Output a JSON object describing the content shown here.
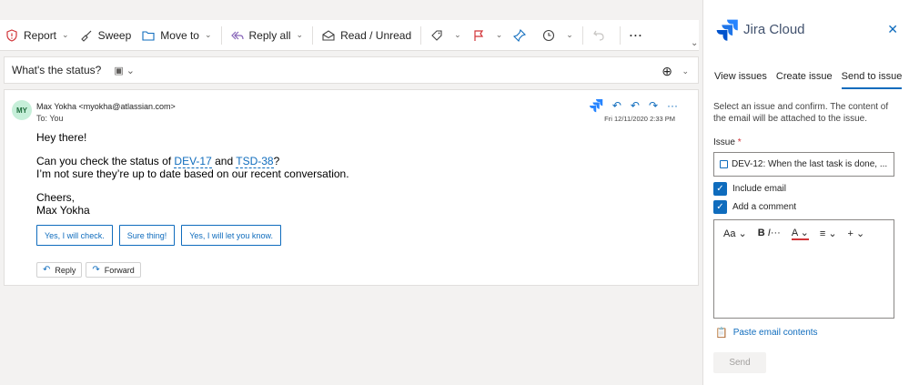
{
  "toolbar": {
    "report_label": "Report",
    "sweep_label": "Sweep",
    "move_to_label": "Move to",
    "reply_all_label": "Reply all",
    "read_unread_label": "Read / Unread",
    "more_label": "···"
  },
  "subject": {
    "text": "What's the status?"
  },
  "message": {
    "avatar_initials": "MY",
    "sender": "Max Yokha <myokha@atlassian.com>",
    "to": "To:  You",
    "date": "Fri 12/11/2020 2:33 PM",
    "greeting": "Hey there!",
    "line1_prefix": "Can you check the status of ",
    "issue1": "DEV-17",
    "line1_and": " and ",
    "issue2": "TSD-38",
    "line1_suffix": "?",
    "line2": "I’m not sure they’re up to date based on our recent conversation.",
    "closing": "Cheers,",
    "signature": "Max Yokha",
    "quick_replies": [
      "Yes, I will check.",
      "Sure thing!",
      "Yes, I will let you know."
    ],
    "reply_label": "Reply",
    "forward_label": "Forward"
  },
  "jira": {
    "title": "Jira Cloud",
    "tabs": [
      "View issues",
      "Create issue",
      "Send to issue"
    ],
    "active_tab": "Send to issue",
    "description": "Select an issue and confirm. The content of the email will be attached to the issue.",
    "issue_label": "Issue",
    "issue_required_mark": "*",
    "issue_value": "DEV-12: When the last task is done, ...",
    "include_email_label": "Include email",
    "add_comment_label": "Add a comment",
    "include_email_checked": true,
    "add_comment_checked": true,
    "editor_tools": [
      "Aa",
      "B",
      "I",
      "A",
      "≡",
      "+"
    ],
    "paste_label": "Paste email contents",
    "send_label": "Send"
  },
  "colors": {
    "accent": "#0f6cbd",
    "avatar_bg": "#c6efd9",
    "jira_blue": "#2684ff"
  }
}
